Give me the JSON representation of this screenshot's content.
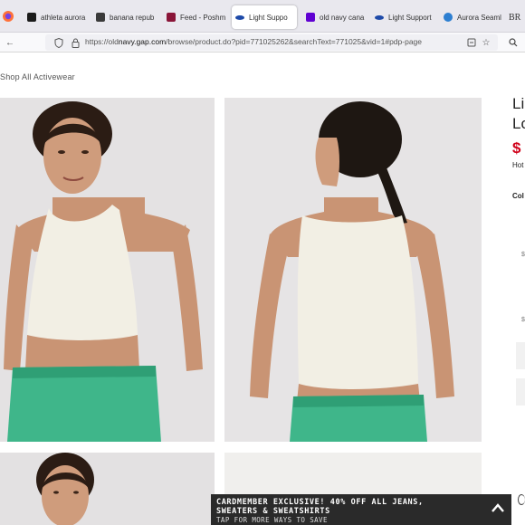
{
  "browser": {
    "tabs": [
      {
        "label": "athleta aurora",
        "favicon_color": "#1b1b1b"
      },
      {
        "label": "banana repub",
        "favicon_color": "#3a3a3a"
      },
      {
        "label": "Feed - Poshm",
        "favicon_color": "#8a1538"
      },
      {
        "label": "Light Suppo",
        "favicon_color": "#1e4aa8",
        "active": true
      },
      {
        "label": "old navy cana",
        "favicon_color": "#6001d2"
      },
      {
        "label": "Light Support",
        "favicon_color": "#1e4aa8"
      },
      {
        "label": "Aurora Seamle",
        "favicon_color": "#2d7fd1"
      },
      {
        "label": "BR",
        "favicon_color": "#000000"
      }
    ],
    "url_prefix": "https://old",
    "url_domain": "navy.gap.com",
    "url_path": "/browse/product.do?pid=771025262&searchText=771025&vid=1#pdp-page"
  },
  "page": {
    "breadcrumb": "Shop All Activewear",
    "product_title": "Li\nLo",
    "price": "$",
    "price_note": "Hot",
    "color_label": "Col",
    "swatch_texts": [
      "$",
      "$"
    ]
  },
  "promo": {
    "line1": "CARDMEMBER EXCLUSIVE! 40% OFF ALL JEANS,",
    "line2": "SWEATERS & SWEATSHIRTS",
    "line3": "TAP FOR MORE WAYS TO SAVE"
  },
  "colors": {
    "accent_price": "#d0021b",
    "promo_bg": "#2a2a2a",
    "top_color": "#f2efe4",
    "shorts_color": "#3fb68a"
  }
}
